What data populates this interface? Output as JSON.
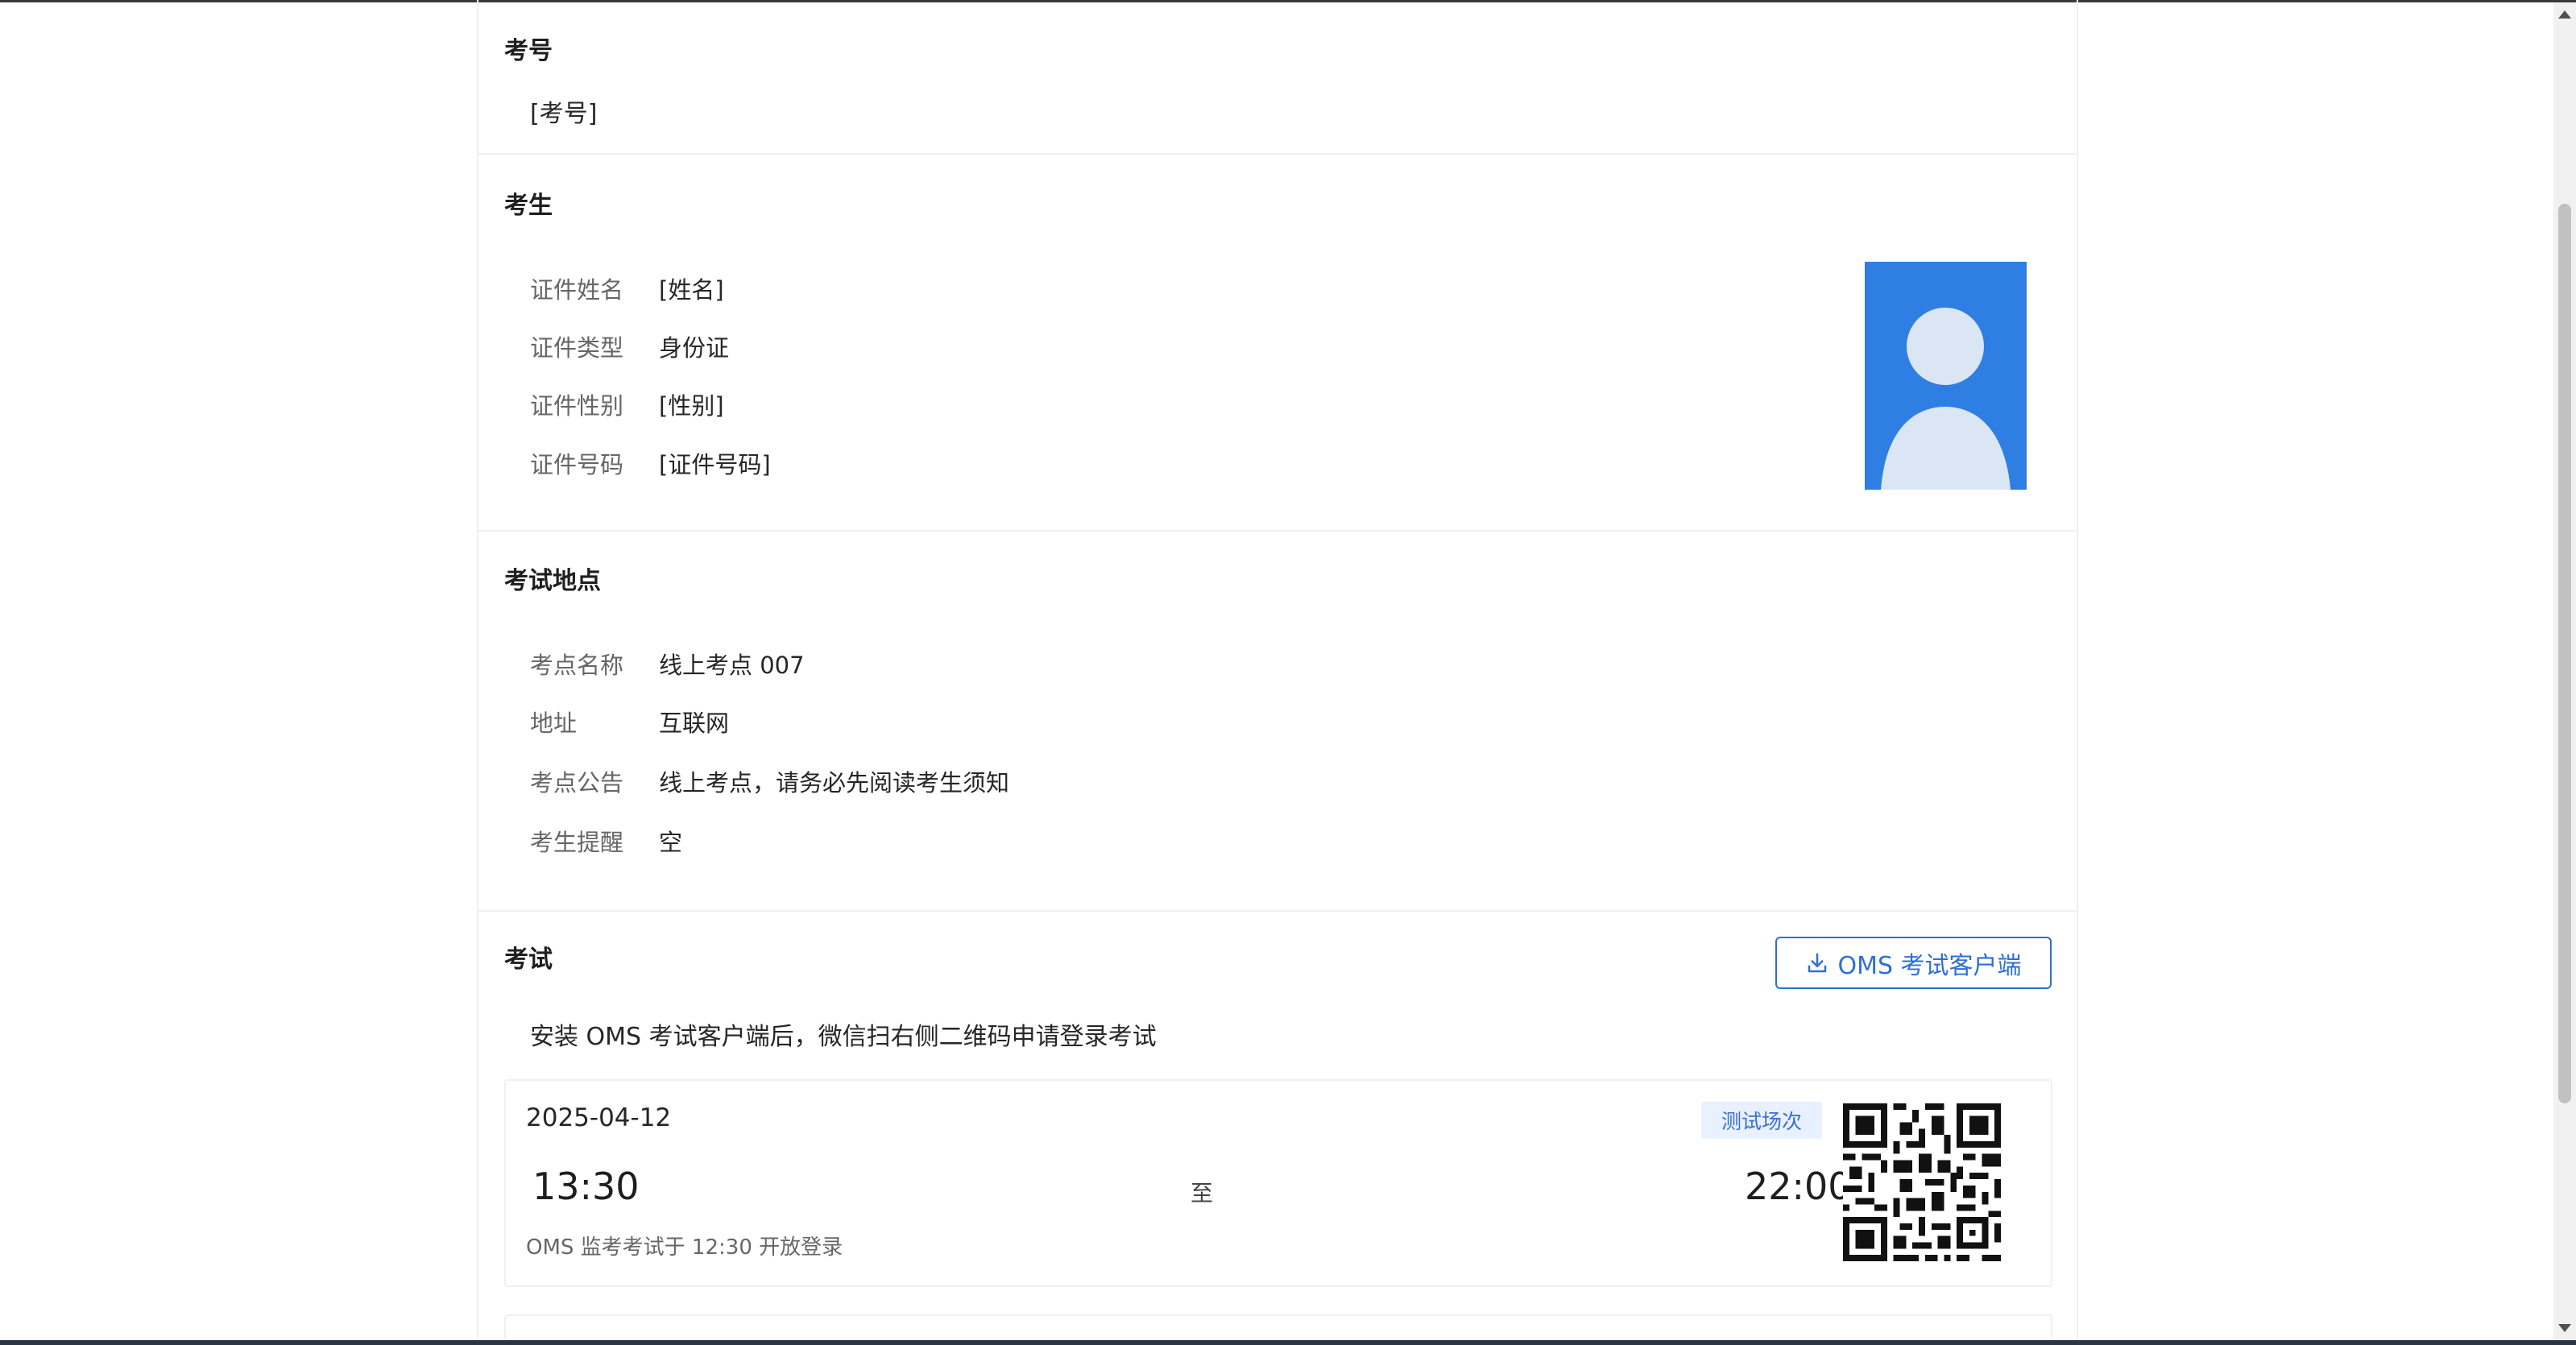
{
  "exam_number": {
    "title": "考号",
    "value": "[考号]"
  },
  "candidate": {
    "title": "考生",
    "fields": [
      {
        "label": "证件姓名",
        "value": "[姓名]"
      },
      {
        "label": "证件类型",
        "value": "身份证"
      },
      {
        "label": "证件性别",
        "value": "[性别]"
      },
      {
        "label": "证件号码",
        "value": "[证件号码]"
      }
    ]
  },
  "location": {
    "title": "考试地点",
    "fields": [
      {
        "label": "考点名称",
        "value": "线上考点 007"
      },
      {
        "label": "地址",
        "value": "互联网"
      },
      {
        "label": "考点公告",
        "value": "线上考点，请务必先阅读考生须知"
      },
      {
        "label": "考生提醒",
        "value": "空"
      }
    ]
  },
  "exam": {
    "title": "考试",
    "download_button": "OMS 考试客户端",
    "instruction": "安装 OMS 考试客户端后，微信扫右侧二维码申请登录考试",
    "session": {
      "date": "2025-04-12",
      "tag": "测试场次",
      "start": "13:30",
      "to": "至",
      "end": "22:00",
      "note": "OMS 监考考试于 12:30 开放登录"
    }
  },
  "colors": {
    "accent": "#2f6fd6",
    "tag_bg": "#e9f0ff",
    "photo_bg": "#2f7ee3"
  }
}
